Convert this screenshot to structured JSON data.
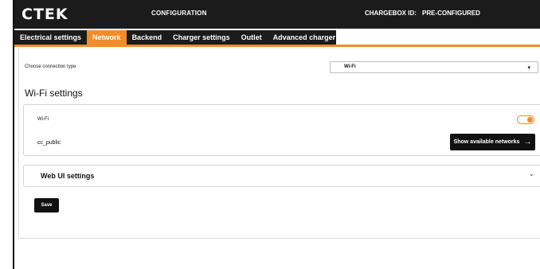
{
  "header": {
    "logo": "CTEK",
    "title": "CONFIGURATION",
    "chargebox_label": "CHARGEBOX ID:",
    "chargebox_value": "PRE-CONFIGURED"
  },
  "tabs": [
    {
      "label": "Electrical settings",
      "active": false
    },
    {
      "label": "Network",
      "active": true
    },
    {
      "label": "Backend",
      "active": false
    },
    {
      "label": "Charger settings",
      "active": false
    },
    {
      "label": "Outlet",
      "active": false
    },
    {
      "label": "Advanced charger settings",
      "active": false
    }
  ],
  "connection": {
    "label": "Choose connection type",
    "selected": "Wi-Fi",
    "caret_icon": "chevron-down-icon"
  },
  "wifi_section": {
    "title": "Wi-Fi settings",
    "toggle_label": "Wi-Fi",
    "toggle_on": true,
    "ssid": "cc_public",
    "networks_button": "Show available networks",
    "networks_icon": "arrow-right-icon"
  },
  "webui": {
    "title": "Web UI settings",
    "chevron_icon": "chevron-down-icon"
  },
  "actions": {
    "save_label": "Save"
  },
  "colors": {
    "accent": "#f28c28",
    "header_bg": "#1b1b1b",
    "button_bg": "#111111"
  }
}
